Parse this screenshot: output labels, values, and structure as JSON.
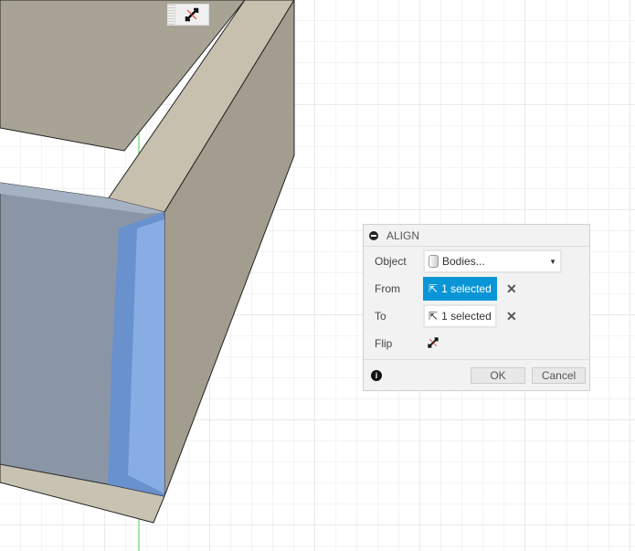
{
  "dialog": {
    "title": "ALIGN",
    "object": {
      "label": "Object",
      "value": "Bodies..."
    },
    "from": {
      "label": "From",
      "value": "1 selected"
    },
    "to": {
      "label": "To",
      "value": "1 selected"
    },
    "flip": {
      "label": "Flip"
    },
    "ok": "OK",
    "cancel": "Cancel"
  },
  "colors": {
    "accent": "#0a96d6",
    "selection": "#5b8fe0"
  }
}
